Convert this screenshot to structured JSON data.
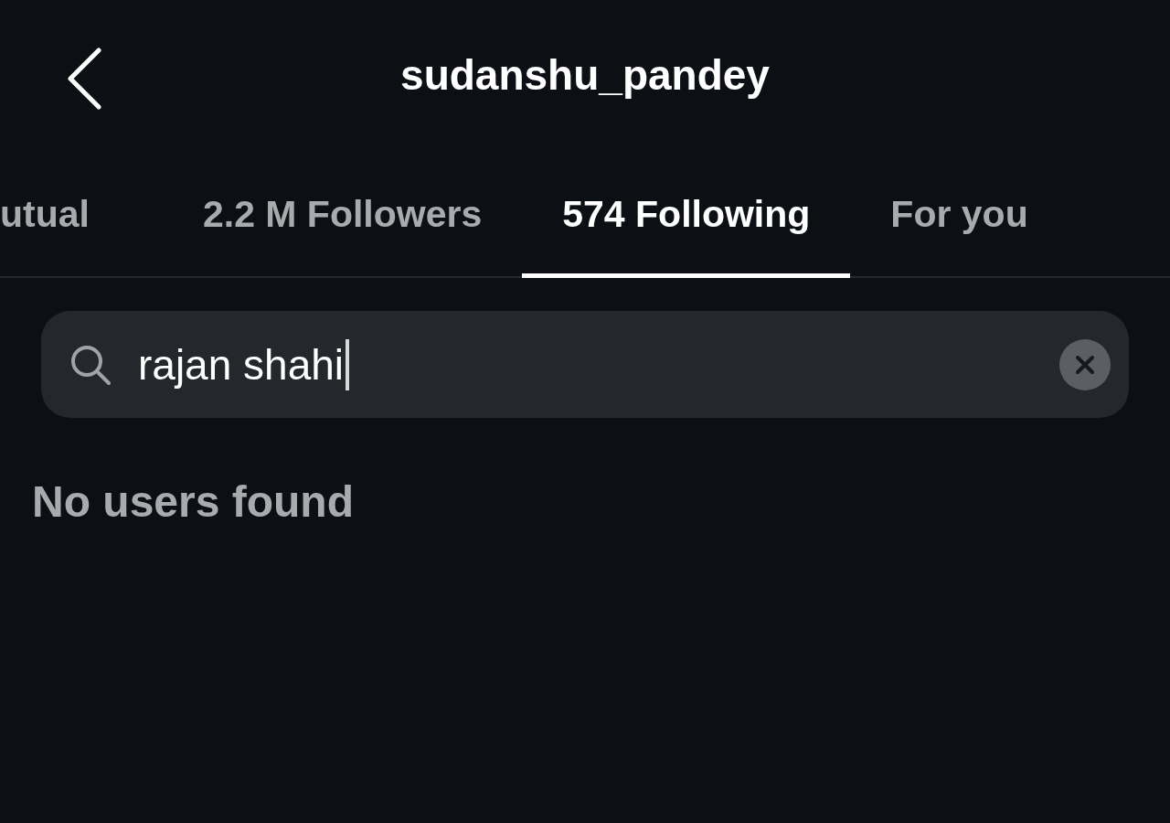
{
  "header": {
    "title": "sudanshu_pandey"
  },
  "tabs": [
    {
      "label": "utual",
      "selected": false
    },
    {
      "label": "2.2 M Followers",
      "selected": false
    },
    {
      "label": "574 Following",
      "selected": true
    },
    {
      "label": "For you",
      "selected": false
    }
  ],
  "search": {
    "value": "rajan shahi",
    "focused": true
  },
  "message": "No users found"
}
